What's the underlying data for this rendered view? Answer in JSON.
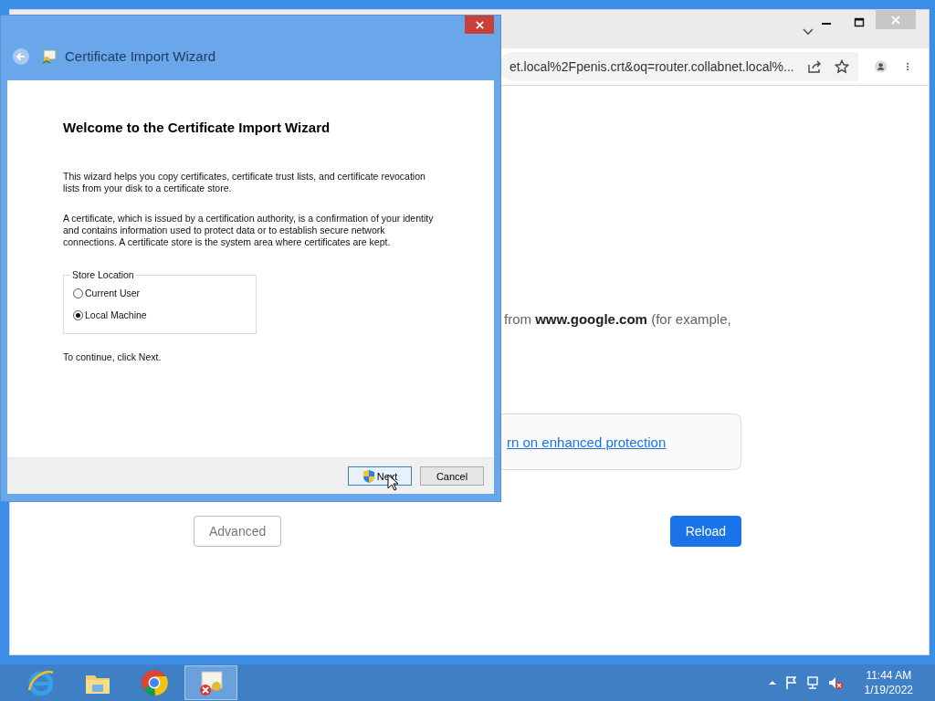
{
  "browser": {
    "address": "et.local%2Fpenis.crt&oq=router.collabnet.local%...",
    "page": {
      "text": "from **www.google.com** (for example,",
      "link": "rn on enhanced protection",
      "buttons": [
        {
          "label": "Advanced",
          "kind": "secondary"
        },
        {
          "label": "Reload",
          "kind": "primary"
        }
      ]
    }
  },
  "dialog": {
    "title": "Certificate Import Wizard",
    "heading": "Welcome to the Certificate Import Wizard",
    "paragraphs": [
      "This wizard helps you copy certificates, certificate trust lists, and certificate revocation\nlists from your disk to a certificate store.",
      "A certificate, which is issued by a certification authority, is a confirmation of your identity\nand contains information used to protect data or to establish secure network\nconnections. A certificate store is the system area where certificates are kept."
    ],
    "store_location": {
      "label": "Store Location",
      "options": [
        {
          "label": "Current User",
          "selected": false
        },
        {
          "label": "Local Machine",
          "selected": true
        }
      ]
    },
    "hint": "To continue, click Next.",
    "buttons": [
      {
        "label": "Next",
        "kind": "shield"
      },
      {
        "label": "Cancel",
        "kind": "plain"
      }
    ]
  },
  "taskbar": {
    "apps": [
      {
        "kind": "ie",
        "selected": false
      },
      {
        "kind": "explorer",
        "selected": false
      },
      {
        "kind": "chrome",
        "selected": false
      },
      {
        "kind": "certificate",
        "selected": true
      }
    ],
    "clock": {
      "time": "11:44 AM",
      "date": "1/19/2022"
    }
  }
}
